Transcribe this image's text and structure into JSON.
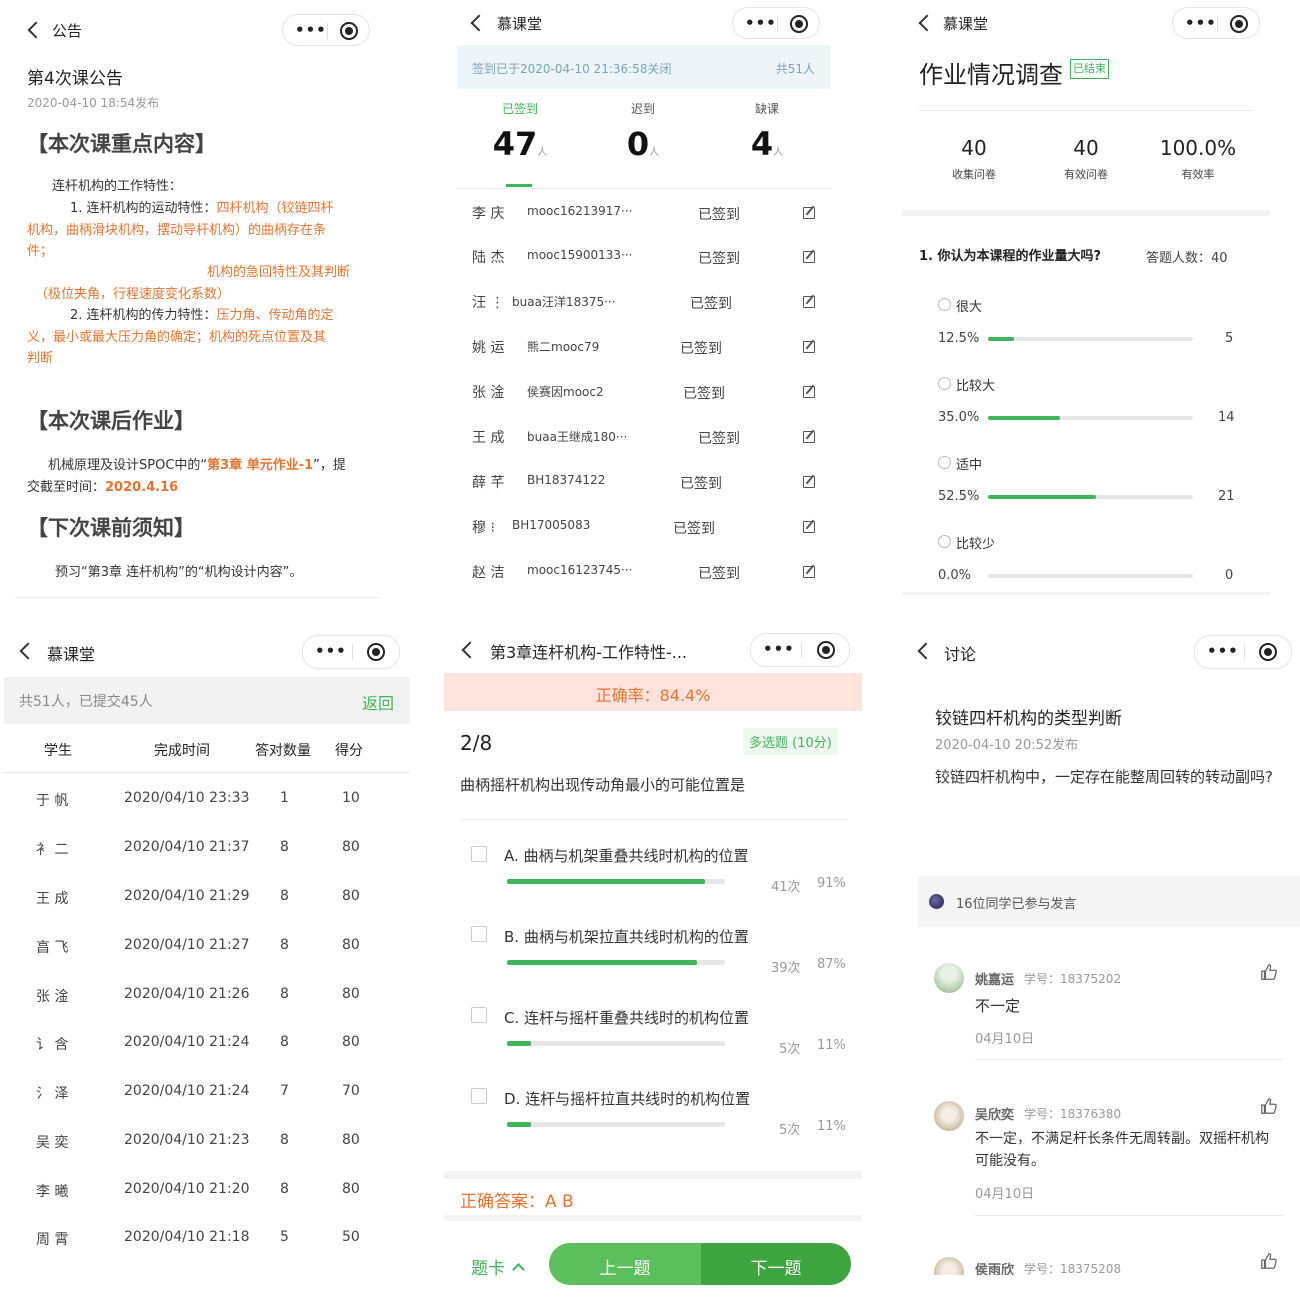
{
  "colors": {
    "accent_green": "#40b45a",
    "accent_orange": "#e67430",
    "banner_bg": "#fde3dc",
    "grey_text": "#999999"
  },
  "p1": {
    "nav_title": "公告",
    "title": "第4次课公告",
    "date": "2020-04-10 18:54发布",
    "h_key": "【本次课重点内容】",
    "s1": "连杆机构的工作特性：",
    "l1a": "1. 连杆机构的运动特性：",
    "l1b": "四杆机构（铰链四杆",
    "l2": "机构，曲柄滑块机构，摆动导杆机构）的曲柄存在条",
    "l3": "件；",
    "l4": "机构的急回特性及其判断",
    "l5": "（极位夹角，行程速度变化系数）",
    "l6a": "2. 连杆机构的传力特性：",
    "l6b": "压力角、传动角的定",
    "l7": "义，最小或最大压力角的确定；机构的死点位置及其",
    "l8": "判断",
    "h_hw": "【本次课后作业】",
    "hw1a": "机械原理及设计SPOC中的“",
    "hw1b": "第3章 单元作业-1",
    "hw1c": "”，提",
    "hw2a": "交截至时间：",
    "hw2b": "2020.4.16",
    "h_next": "【下次课前须知】",
    "next": "预习“第3章 连杆机构”的“机构设计内容”。"
  },
  "p2": {
    "nav_title": "慕课堂",
    "banner": "签到已于2020-04-10 21:36:58关闭",
    "total": "共51人",
    "stats": [
      {
        "label": "已签到",
        "value": "47",
        "unit": "人"
      },
      {
        "label": "迟到",
        "value": "0",
        "unit": "人"
      },
      {
        "label": "缺课",
        "value": "4",
        "unit": "人"
      }
    ],
    "rows": [
      {
        "name": "李  庆",
        "id": "mooc16213917···",
        "status": "已签到"
      },
      {
        "name": "陆  杰",
        "id": "mooc15900133···",
        "status": "已签到"
      },
      {
        "name": "汪  ⋮",
        "id": "buaa汪洋18375···",
        "status": "已签到"
      },
      {
        "name": "姚  运",
        "id": "熊二mooc79",
        "status": "已签到"
      },
      {
        "name": "张  淦",
        "id": "侯赛因mooc2",
        "status": "已签到"
      },
      {
        "name": "王  成",
        "id": "buaa王继成180···",
        "status": "已签到"
      },
      {
        "name": "薛  芊",
        "id": "BH18374122",
        "status": "已签到"
      },
      {
        "name": "穆  ⁝",
        "id": "BH17005083",
        "status": "已签到"
      },
      {
        "name": "赵  洁",
        "id": "mooc16123745···",
        "status": "已签到"
      }
    ]
  },
  "p3": {
    "nav_title": "慕课堂",
    "title": "作业情况调查",
    "badge": "已结束",
    "stats": [
      {
        "value": "40",
        "label": "收集问卷"
      },
      {
        "value": "40",
        "label": "有效问卷"
      },
      {
        "value": "100.0%",
        "label": "有效率"
      }
    ],
    "question": "1. 你认为本课程的作业量大吗?",
    "answer_count": "答题人数：40",
    "options": [
      {
        "label": "很大",
        "pct": "12.5%",
        "fraction": 0.125,
        "count": "5"
      },
      {
        "label": "比较大",
        "pct": "35.0%",
        "fraction": 0.35,
        "count": "14"
      },
      {
        "label": "适中",
        "pct": "52.5%",
        "fraction": 0.525,
        "count": "21"
      },
      {
        "label": "比较少",
        "pct": "0.0%",
        "fraction": 0.0,
        "count": "0"
      }
    ]
  },
  "p4": {
    "nav_title": "慕课堂",
    "summary": "共51人，已提交45人",
    "back": "返回",
    "headers": [
      "学生",
      "完成时间",
      "答对数量",
      "得分"
    ],
    "rows": [
      {
        "name": "于  帆",
        "time": "2020/04/10 23:33",
        "correct": "1",
        "score": "10"
      },
      {
        "name": "衤  二",
        "time": "2020/04/10 21:37",
        "correct": "8",
        "score": "80"
      },
      {
        "name": "王  成",
        "time": "2020/04/10 21:29",
        "correct": "8",
        "score": "80"
      },
      {
        "name": "亯  飞",
        "time": "2020/04/10 21:27",
        "correct": "8",
        "score": "80"
      },
      {
        "name": "张  淦",
        "time": "2020/04/10 21:26",
        "correct": "8",
        "score": "80"
      },
      {
        "name": "讠  含",
        "time": "2020/04/10 21:24",
        "correct": "8",
        "score": "80"
      },
      {
        "name": "氵  泽",
        "time": "2020/04/10 21:24",
        "correct": "7",
        "score": "70"
      },
      {
        "name": "吴  奕",
        "time": "2020/04/10 21:23",
        "correct": "8",
        "score": "80"
      },
      {
        "name": "李  曦",
        "time": "2020/04/10 21:20",
        "correct": "8",
        "score": "80"
      },
      {
        "name": "周  霄",
        "time": "2020/04/10 21:18",
        "correct": "5",
        "score": "50"
      }
    ]
  },
  "p5": {
    "nav_title": "第3章连杆机构-工作特性-...",
    "accuracy": "正确率：84.4%",
    "progress": "2/8",
    "qtype": "多选题 (10分)",
    "question": "曲柄摇杆机构出现传动角最小的可能位置是",
    "options": [
      {
        "text": "A. 曲柄与机架重叠共线时机构的位置",
        "count": "41次",
        "pct": "91%",
        "fraction": 0.91
      },
      {
        "text": "B. 曲柄与机架拉直共线时机构的位置",
        "count": "39次",
        "pct": "87%",
        "fraction": 0.87
      },
      {
        "text": "C. 连杆与摇杆重叠共线时的机构位置",
        "count": "5次",
        "pct": "11%",
        "fraction": 0.11
      },
      {
        "text": "D. 连杆与摇杆拉直共线时的机构位置",
        "count": "5次",
        "pct": "11%",
        "fraction": 0.11
      }
    ],
    "answer": "正确答案：A B",
    "card_label": "题卡",
    "prev": "上一题",
    "next": "下一题"
  },
  "p6": {
    "nav_title": "讨论",
    "title": "铰链四杆机构的类型判断",
    "date": "2020-04-10 20:52发布",
    "body": "铰链四杆机构中，一定存在能整周回转的转动副吗?",
    "participants": "16位同学已参与发言",
    "comments": [
      {
        "name": "姚嘉运",
        "sid": "学号：18375202",
        "text": "不一定",
        "date": "04月10日"
      },
      {
        "name": "吴欣奕",
        "sid": "学号：18376380",
        "text": "不一定，不满足杆长条件无周转副。双摇杆机构可能没有。",
        "date": "04月10日"
      },
      {
        "name": "侯雨欣",
        "sid": "学号：18375208",
        "text": "",
        "date": ""
      }
    ]
  }
}
